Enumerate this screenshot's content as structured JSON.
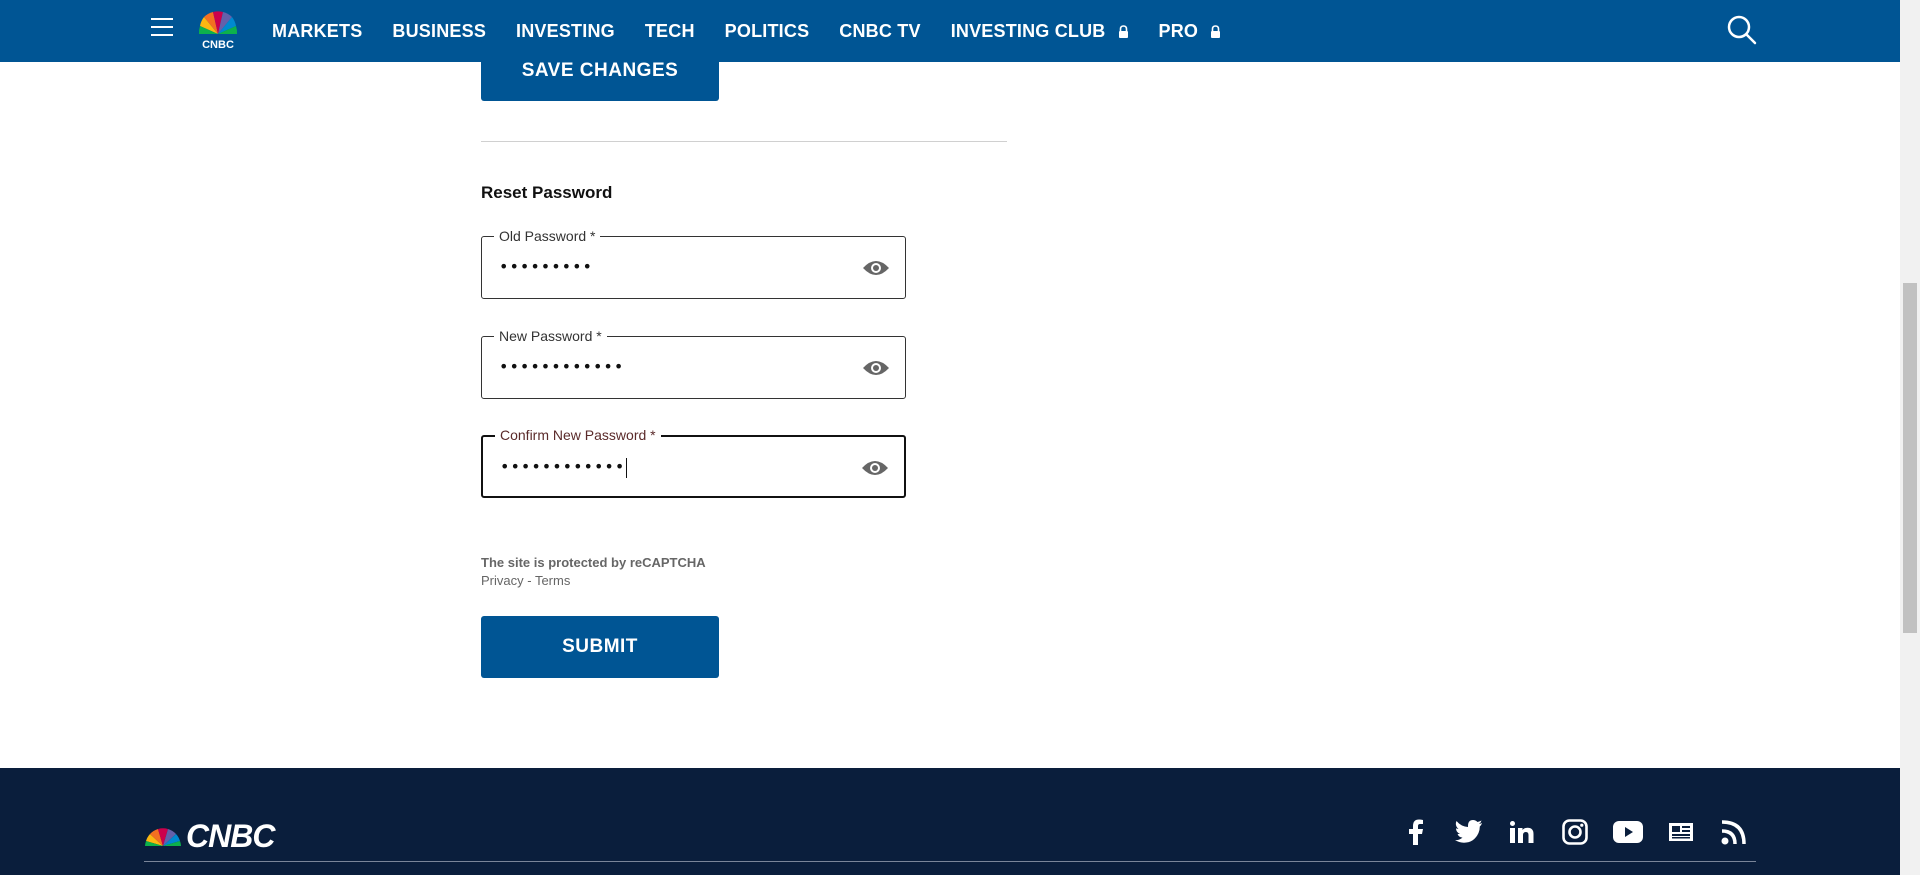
{
  "nav": {
    "links": [
      {
        "label": "MARKETS",
        "locked": false
      },
      {
        "label": "BUSINESS",
        "locked": false
      },
      {
        "label": "INVESTING",
        "locked": false
      },
      {
        "label": "TECH",
        "locked": false
      },
      {
        "label": "POLITICS",
        "locked": false
      },
      {
        "label": "CNBC TV",
        "locked": false
      },
      {
        "label": "INVESTING CLUB",
        "locked": true
      },
      {
        "label": "PRO",
        "locked": true
      }
    ],
    "logo_text": "CNBC"
  },
  "main": {
    "save_label": "SAVE CHANGES",
    "reset_title": "Reset Password",
    "fields": [
      {
        "label": "Old Password *",
        "value": "•••••••••",
        "focused": false
      },
      {
        "label": "New Password *",
        "value": "••••••••••••",
        "focused": false
      },
      {
        "label": "Confirm New Password *",
        "value": "••••••••••••",
        "focused": true
      }
    ],
    "recaptcha": {
      "text": "The site is protected by reCAPTCHA",
      "privacy": "Privacy",
      "separator": " - ",
      "terms": "Terms"
    },
    "submit_label": "SUBMIT"
  },
  "footer": {
    "logo_text": "CNBC",
    "social": [
      "facebook-icon",
      "twitter-icon",
      "linkedin-icon",
      "instagram-icon",
      "youtube-icon",
      "news-icon",
      "rss-icon"
    ]
  },
  "colors": {
    "brand_blue": "#005594",
    "footer_navy": "#0a1e3c"
  }
}
